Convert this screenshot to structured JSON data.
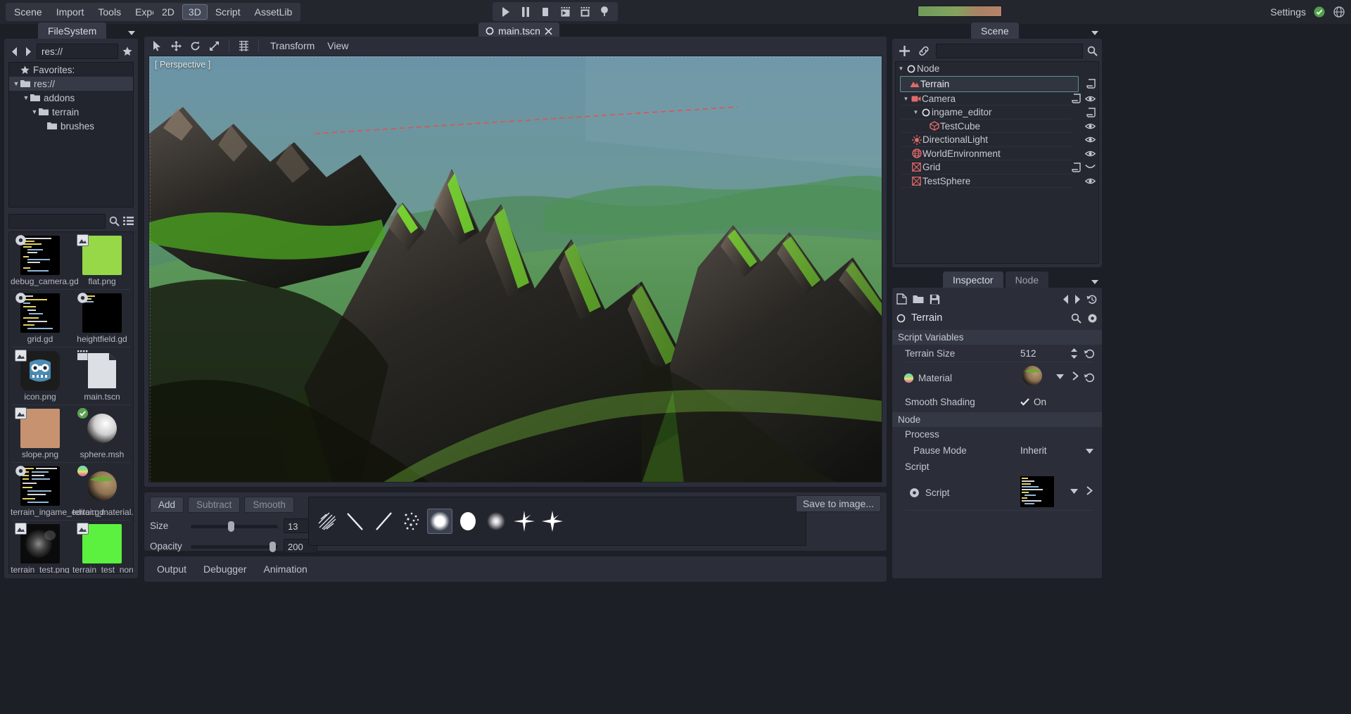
{
  "app": {
    "menus": [
      "Scene",
      "Import",
      "Tools",
      "Export"
    ],
    "modes": [
      "2D",
      "3D",
      "Script",
      "AssetLib"
    ],
    "active_mode": "3D",
    "playback": [
      "play-icon",
      "pause-icon",
      "stop-icon",
      "play-scene-icon",
      "play-custom-scene-icon",
      "remote-debug-icon"
    ],
    "settings_label": "Settings",
    "progress_percent": 100
  },
  "filesystem": {
    "tab_label": "FileSystem",
    "path_value": "res://",
    "search_placeholder": "",
    "tree": [
      {
        "label": "Favorites:",
        "icon": "star-icon",
        "depth": 0,
        "arrow": "",
        "selected": false
      },
      {
        "label": "res://",
        "icon": "folder-icon",
        "depth": 0,
        "arrow": "down",
        "selected": true
      },
      {
        "label": "addons",
        "icon": "folder-icon",
        "depth": 1,
        "arrow": "down",
        "selected": false
      },
      {
        "label": "terrain",
        "icon": "folder-icon",
        "depth": 2,
        "arrow": "down",
        "selected": false
      },
      {
        "label": "brushes",
        "icon": "folder-icon",
        "depth": 3,
        "arrow": "",
        "selected": false
      }
    ],
    "files": [
      {
        "name": "debug_camera.gd",
        "thumb": "script",
        "badge": "gear-icon"
      },
      {
        "name": "flat.png",
        "thumb": "flat-green",
        "badge": "image-icon"
      },
      {
        "name": "grid.gd",
        "thumb": "script",
        "badge": "gear-icon"
      },
      {
        "name": "heightfield.gd",
        "thumb": "script-sparse",
        "badge": "gear-icon"
      },
      {
        "name": "icon.png",
        "thumb": "godot-icon",
        "badge": "image-icon"
      },
      {
        "name": "main.tscn",
        "thumb": "scene-doc",
        "badge": "scene-icon"
      },
      {
        "name": "slope.png",
        "thumb": "slope-brown",
        "badge": "image-icon"
      },
      {
        "name": "sphere.msh",
        "thumb": "sphere-grey",
        "badge": "check-icon"
      },
      {
        "name": "terrain_ingame_editor.gd",
        "thumb": "script",
        "badge": "gear-icon"
      },
      {
        "name": "terrain_material.tres",
        "thumb": "sphere-terrain",
        "badge": "material-icon"
      },
      {
        "name": "terrain_test.png",
        "thumb": "noise-dark",
        "badge": "image-icon"
      },
      {
        "name": "terrain_test_normal_map.png",
        "thumb": "flat-bright-green",
        "badge": "image-icon"
      }
    ]
  },
  "editor": {
    "scene_tab": "main.tscn",
    "scene_tab_icon": "node-icon",
    "scene_tab_close": "close-icon",
    "viewport": {
      "tools": [
        "select-icon",
        "move-icon",
        "rotate-icon",
        "scale-icon",
        "snap-icon"
      ],
      "menus": [
        "Transform",
        "View"
      ],
      "perspective_label": "[ Perspective ]"
    }
  },
  "brush_panel": {
    "modes": [
      {
        "label": "Add",
        "active": true
      },
      {
        "label": "Subtract",
        "active": false
      },
      {
        "label": "Smooth",
        "active": false
      }
    ],
    "size_label": "Size",
    "size_value": "13",
    "size_percent": 46,
    "opacity_label": "Opacity",
    "opacity_value": "200",
    "opacity_percent": 96,
    "brushes": [
      {
        "name": "scribble-brush",
        "selected": false
      },
      {
        "name": "stroke-left-brush",
        "selected": false
      },
      {
        "name": "stroke-right-brush",
        "selected": false
      },
      {
        "name": "speckle-brush",
        "selected": false
      },
      {
        "name": "soft-round-brush",
        "selected": true
      },
      {
        "name": "hard-round-brush",
        "selected": false
      },
      {
        "name": "small-soft-brush",
        "selected": false
      },
      {
        "name": "star-brush",
        "selected": false
      },
      {
        "name": "sparkle-brush",
        "selected": false
      }
    ],
    "save_label": "Save to image..."
  },
  "bottom_dock": {
    "tabs": [
      "Output",
      "Debugger",
      "Animation"
    ]
  },
  "scene_dock": {
    "tab_label": "Scene",
    "filter_placeholder": "",
    "nodes": [
      {
        "label": "Node",
        "icon": "node-icon",
        "depth": 0,
        "arrow": "down",
        "selected": false,
        "script": false,
        "visibility": "none"
      },
      {
        "label": "Terrain",
        "icon": "terrain-icon",
        "depth": 1,
        "arrow": "",
        "selected": true,
        "script": true,
        "visibility": "none"
      },
      {
        "label": "Camera",
        "icon": "camera-icon",
        "depth": 1,
        "arrow": "down",
        "selected": false,
        "script": true,
        "visibility": "eye"
      },
      {
        "label": "ingame_editor",
        "icon": "node-icon",
        "depth": 2,
        "arrow": "down",
        "selected": false,
        "script": true,
        "visibility": "none"
      },
      {
        "label": "TestCube",
        "icon": "mesh-icon",
        "depth": 3,
        "arrow": "",
        "selected": false,
        "script": false,
        "visibility": "eye"
      },
      {
        "label": "DirectionalLight",
        "icon": "light-icon",
        "depth": 1,
        "arrow": "",
        "selected": false,
        "script": false,
        "visibility": "eye"
      },
      {
        "label": "WorldEnvironment",
        "icon": "world-icon",
        "depth": 1,
        "arrow": "",
        "selected": false,
        "script": false,
        "visibility": "eye"
      },
      {
        "label": "Grid",
        "icon": "immediate-geometry-icon",
        "depth": 1,
        "arrow": "",
        "selected": false,
        "script": true,
        "visibility": "closed-eye"
      },
      {
        "label": "TestSphere",
        "icon": "immediate-geometry-icon",
        "depth": 1,
        "arrow": "",
        "selected": false,
        "script": false,
        "visibility": "eye"
      }
    ]
  },
  "inspector": {
    "tabs": [
      {
        "label": "Inspector",
        "active": true
      },
      {
        "label": "Node",
        "active": false
      }
    ],
    "tools": [
      "new-resource-icon",
      "open-resource-icon",
      "save-resource-icon",
      "history-prev-icon",
      "history-next-icon",
      "history-icon"
    ],
    "node_name": "Terrain",
    "node_icon": "node-icon",
    "search_icon": "search-icon",
    "options_icon": "gear-icon",
    "sections": [
      {
        "header": "Script Variables",
        "rows": [
          {
            "label": "Terrain Size",
            "value": "512",
            "kind": "number"
          },
          {
            "label": "Material",
            "value": "",
            "kind": "resource-preview",
            "icon": "material-icon"
          },
          {
            "label": "Smooth Shading",
            "value": "On",
            "kind": "checkbox",
            "checked": true
          }
        ]
      },
      {
        "header": "Node",
        "sub": "Process",
        "rows": [
          {
            "label": "Pause Mode",
            "value": "Inherit",
            "kind": "enum"
          }
        ]
      },
      {
        "header": "",
        "sub": "Script",
        "rows": [
          {
            "label": "Script",
            "value": "",
            "kind": "script-preview",
            "icon": "gear-icon"
          }
        ]
      }
    ]
  },
  "colors": {
    "panel": "#2b2e39",
    "background": "#1d1f26",
    "accent": "#5f8f95",
    "node_red": "#e06a6a",
    "sky": "#6f93a5",
    "terrain_green": "#58c223"
  }
}
